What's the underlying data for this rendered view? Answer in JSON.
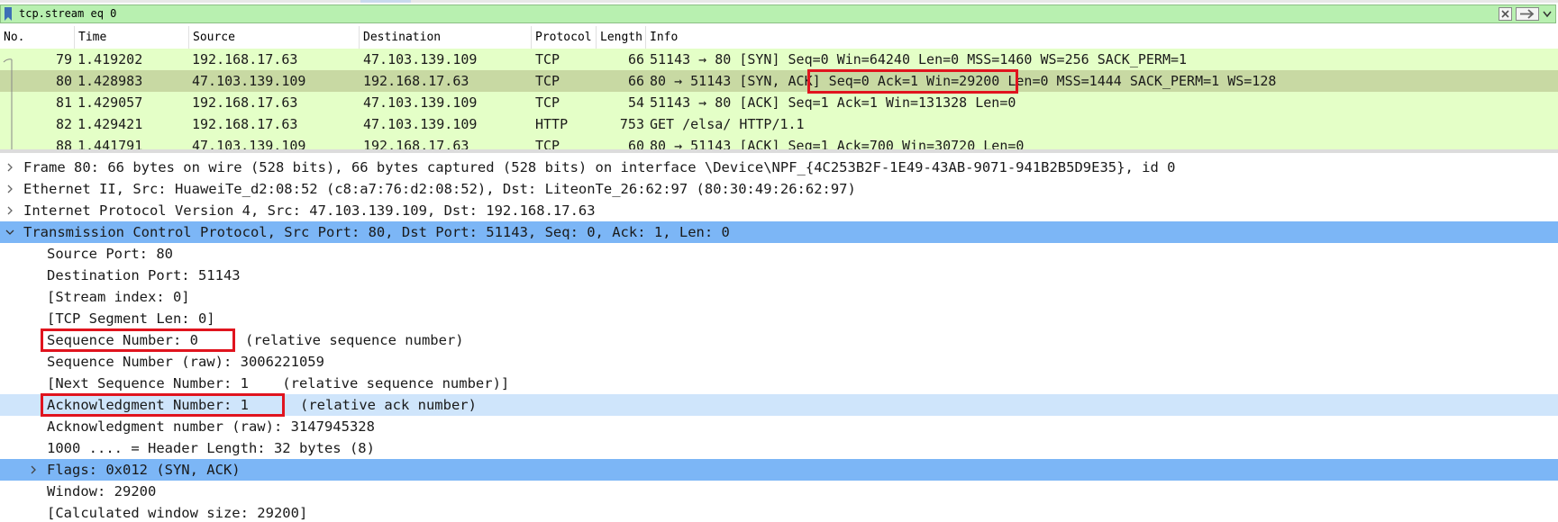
{
  "filter": {
    "value": "tcp.stream eq 0"
  },
  "columns": [
    "No.",
    "Time",
    "Source",
    "Destination",
    "Protocol",
    "Length",
    "Info"
  ],
  "packets": [
    {
      "no": "79",
      "time": "1.419202",
      "source": "192.168.17.63",
      "destination": "47.103.139.109",
      "protocol": "TCP",
      "length": "66",
      "info": "51143 → 80 [SYN] Seq=0 Win=64240 Len=0 MSS=1460 WS=256 SACK_PERM=1"
    },
    {
      "no": "80",
      "time": "1.428983",
      "source": "47.103.139.109",
      "destination": "192.168.17.63",
      "protocol": "TCP",
      "length": "66",
      "info_prefix": "80 → 51143 ",
      "info_highlight": "[SYN, ACK] Seq=0 Ack=1",
      "info_suffix": " Win=29200 Len=0 MSS=1444 SACK_PERM=1 WS=128",
      "selected": true
    },
    {
      "no": "81",
      "time": "1.429057",
      "source": "192.168.17.63",
      "destination": "47.103.139.109",
      "protocol": "TCP",
      "length": "54",
      "info": "51143 → 80 [ACK] Seq=1 Ack=1 Win=131328 Len=0"
    },
    {
      "no": "82",
      "time": "1.429421",
      "source": "192.168.17.63",
      "destination": "47.103.139.109",
      "protocol": "HTTP",
      "length": "753",
      "info": "GET /elsa/ HTTP/1.1"
    },
    {
      "no": "88",
      "time": "1.441791",
      "source": "47.103.139.109",
      "destination": "192.168.17.63",
      "protocol": "TCP",
      "length": "60",
      "info": "80 → 51143 [ACK] Seq=1 Ack=700 Win=30720 Len=0"
    }
  ],
  "details": {
    "frame": "Frame 80: 66 bytes on wire (528 bits), 66 bytes captured (528 bits) on interface \\Device\\NPF_{4C253B2F-1E49-43AB-9071-941B2B5D9E35}, id 0",
    "ethernet": "Ethernet II, Src: HuaweiTe_d2:08:52 (c8:a7:76:d2:08:52), Dst: LiteonTe_26:62:97 (80:30:49:26:62:97)",
    "ip": "Internet Protocol Version 4, Src: 47.103.139.109, Dst: 192.168.17.63",
    "tcp": "Transmission Control Protocol, Src Port: 80, Dst Port: 51143, Seq: 0, Ack: 1, Len: 0",
    "src_port": "Source Port: 80",
    "dst_port": "Destination Port: 51143",
    "stream_index": "[Stream index: 0]",
    "seg_len": "[TCP Segment Len: 0]",
    "seq_main": "Sequence Number: 0",
    "seq_note": "(relative sequence number)",
    "seq_raw": "Sequence Number (raw): 3006221059",
    "next_seq": "[Next Sequence Number: 1    (relative sequence number)]",
    "ack_main": "Acknowledgment Number: 1",
    "ack_note": "(relative ack number)",
    "ack_raw": "Acknowledgment number (raw): 3147945328",
    "header_len": "1000 .... = Header Length: 32 bytes (8)",
    "flags": "Flags: 0x012 (SYN, ACK)",
    "window": "Window: 29200",
    "calc_window": "[Calculated window size: 29200]"
  },
  "colors": {
    "filter_bg": "#b8f0b0",
    "row_tcp": "#e4ffc7",
    "row_selected": "#c8d9a3",
    "detail_highlight": "#7cb6f6",
    "detail_light": "#cfe5fb",
    "annotation_red": "#e0141e"
  }
}
